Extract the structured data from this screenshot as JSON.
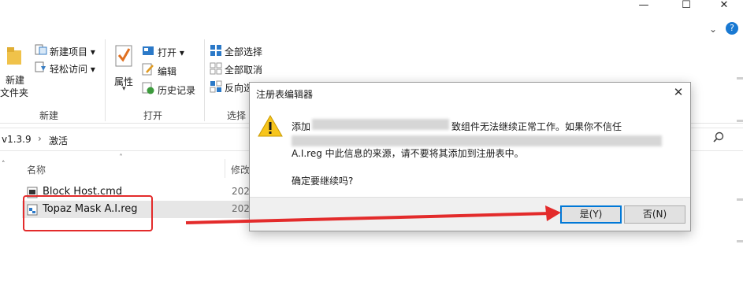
{
  "window": {
    "minimize": "—",
    "maximize": "☐",
    "close": "✕",
    "help": "?",
    "collapse": "⌄"
  },
  "ribbon": {
    "new_folder": "新建",
    "new_folder_line2": "文件夹",
    "new_item": "新建项目",
    "easy_access": "轻松访问",
    "group_new": "新建",
    "properties": "属性",
    "open": "打开",
    "edit": "编辑",
    "history": "历史记录",
    "group_open": "打开",
    "select_all": "全部选择",
    "select_none": "全部取消",
    "invert_selection": "反向选",
    "group_select": "选择"
  },
  "address": {
    "path_part1": "v1.3.9",
    "sep": "›",
    "path_part2": "激活"
  },
  "file_list": {
    "col_name": "名称",
    "col_modified": "修改",
    "files": [
      {
        "name": "Block Host.cmd",
        "date": "202"
      },
      {
        "name": "Topaz Mask A.I.reg",
        "date": "202"
      }
    ]
  },
  "dialog": {
    "title": "注册表编辑器",
    "close": "✕",
    "line1_start": "添加",
    "line1_end": "致组件无法继续正常工作。如果你不信任",
    "line2": "A.I.reg 中此信息的来源，请不要将其添加到注册表中。",
    "question": "确定要继续吗?",
    "yes": "是(Y)",
    "no": "否(N)"
  },
  "colors": {
    "annotation_red": "#e32b2b",
    "accent": "#0078d7",
    "selection": "#e6e6e6"
  }
}
